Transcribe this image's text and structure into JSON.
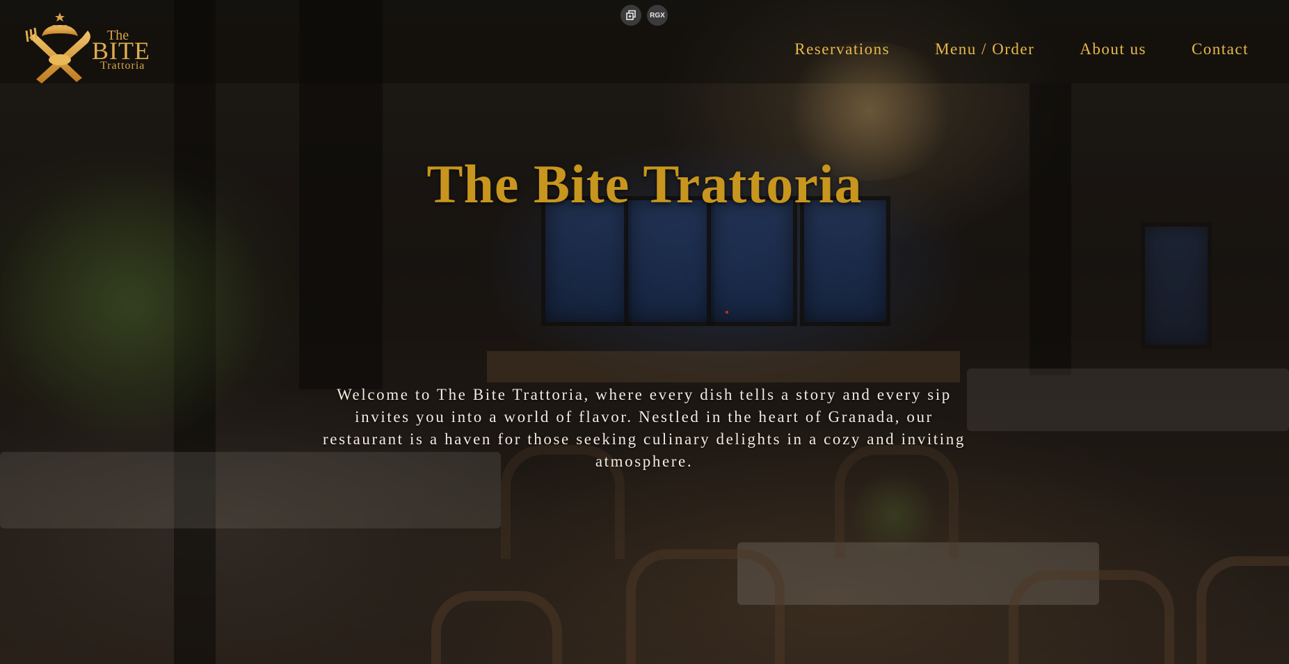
{
  "extension_toolbar": {
    "buttons": [
      {
        "icon": "copy-icon"
      },
      {
        "label": "RGX"
      }
    ]
  },
  "logo": {
    "the": "The",
    "bite": "BITE",
    "trattoria": "Trattoria",
    "icon": "crossed-fork-knife-logo-icon"
  },
  "nav": {
    "items": [
      {
        "label": "Reservations"
      },
      {
        "label": "Menu / Order"
      },
      {
        "label": "About us"
      },
      {
        "label": "Contact"
      }
    ]
  },
  "hero": {
    "title": "The Bite Trattoria",
    "description": "Welcome to The Bite Trattoria, where every dish tells a story and every sip invites you into a world of flavor. Nestled in the heart of Granada, our restaurant is a haven for those seeking culinary delights in a cozy and inviting atmosphere."
  },
  "colors": {
    "accent_gold": "#c8961e",
    "nav_gold": "#e8b94a",
    "text_light": "#f2ece2"
  }
}
